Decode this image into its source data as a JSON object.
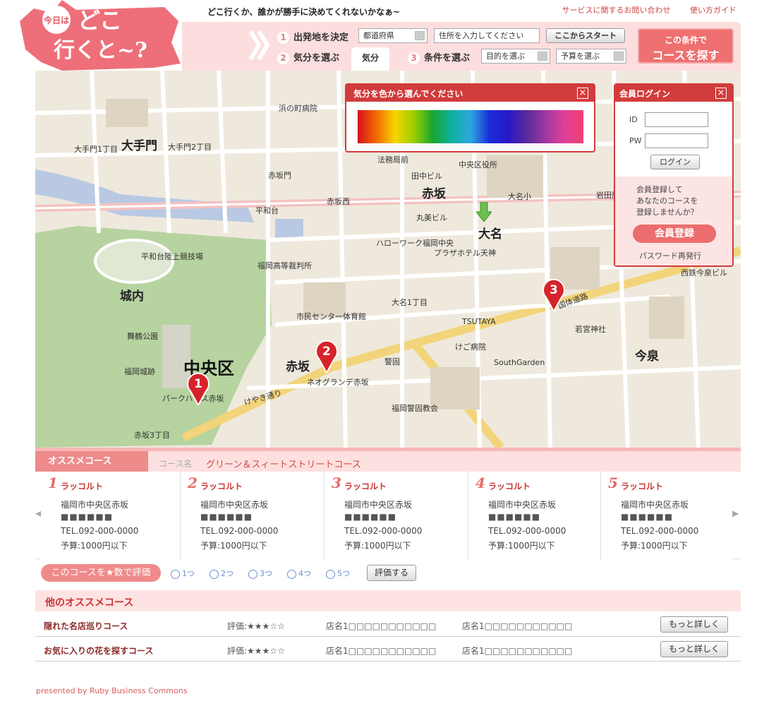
{
  "header": {
    "logo_top": "今日は",
    "logo_main1": "どこ",
    "logo_main2": "行くと~?",
    "tagline": "どこ行くか、誰かが勝手に決めてくれないかなぁ~",
    "links": [
      "サービスに関するお問い合わせ",
      "使い方ガイド"
    ]
  },
  "controls": {
    "step1": {
      "num": "1",
      "label": "出発地を決定",
      "prefecture": "都道府県",
      "address_placeholder": "住所を入力してください",
      "start_button": "ここからスタート"
    },
    "step2": {
      "num": "2",
      "label": "気分を選ぶ",
      "mood_tab": "気分"
    },
    "step3": {
      "num": "3",
      "label": "条件を選ぶ",
      "purpose": "目的を選ぶ",
      "budget": "予算を選ぶ"
    },
    "search_button_line1": "この条件で",
    "search_button_line2": "コースを探す"
  },
  "mood_popup": {
    "title": "気分を色から選んでください",
    "close": "×"
  },
  "login_popup": {
    "title": "会員ログイン",
    "close": "×",
    "id_label": "ID",
    "pw_label": "PW",
    "login_button": "ログイン",
    "register_text1": "会員登録して",
    "register_text2": "あなたのコースを",
    "register_text3": "登録しませんか？",
    "register_button": "会員登録",
    "reissue_link": "パスワード再発行"
  },
  "map": {
    "labels": [
      {
        "t": "大手門",
        "cls": "big"
      },
      {
        "t": "赤坂",
        "cls": "big"
      },
      {
        "t": "大名",
        "cls": "big"
      },
      {
        "t": "中央区",
        "cls": "huge"
      },
      {
        "t": "城内",
        "cls": "big"
      },
      {
        "t": "今泉",
        "cls": "big"
      },
      {
        "t": "赤坂",
        "cls": "big"
      },
      {
        "t": "平和台陸上競技場",
        "cls": ""
      },
      {
        "t": "舞鶴公園",
        "cls": ""
      },
      {
        "t": "福岡城跡",
        "cls": ""
      },
      {
        "t": "市民センター体育館",
        "cls": ""
      },
      {
        "t": "福岡高等裁判所",
        "cls": ""
      },
      {
        "t": "赤坂門",
        "cls": ""
      },
      {
        "t": "平和台",
        "cls": ""
      },
      {
        "t": "赤坂西",
        "cls": ""
      },
      {
        "t": "ハローワーク福岡中央",
        "cls": ""
      },
      {
        "t": "プラザホテル天神",
        "cls": ""
      },
      {
        "t": "大名1丁目",
        "cls": ""
      },
      {
        "t": "TSUTAYA",
        "cls": ""
      },
      {
        "t": "けご病院",
        "cls": ""
      },
      {
        "t": "SouthGarden",
        "cls": ""
      },
      {
        "t": "警固",
        "cls": ""
      },
      {
        "t": "若宮神社",
        "cls": ""
      },
      {
        "t": "国体道路",
        "cls": ""
      },
      {
        "t": "けやき通り",
        "cls": ""
      },
      {
        "t": "ネオグランデ赤坂",
        "cls": ""
      },
      {
        "t": "パークハウス赤坂",
        "cls": ""
      },
      {
        "t": "赤坂3丁目",
        "cls": ""
      },
      {
        "t": "福岡警固教会",
        "cls": ""
      },
      {
        "t": "法務局前",
        "cls": ""
      },
      {
        "t": "中央区役所",
        "cls": ""
      },
      {
        "t": "浜の町病院",
        "cls": ""
      },
      {
        "t": "田中ビル",
        "cls": ""
      },
      {
        "t": "大名小",
        "cls": ""
      },
      {
        "t": "丸美ビル",
        "cls": ""
      },
      {
        "t": "岩田屋",
        "cls": ""
      },
      {
        "t": "西鉄今泉ビル",
        "cls": ""
      },
      {
        "t": "大手門1丁目",
        "cls": ""
      },
      {
        "t": "大手門2丁目",
        "cls": ""
      }
    ],
    "pins": [
      "1",
      "2",
      "3"
    ]
  },
  "recommend": {
    "tab": "オススメコース",
    "course_label": "コース名",
    "course_name": "グリーン＆スィートストリートコース",
    "courses": [
      {
        "num": "1",
        "name": "ラッコルト",
        "addr": "福岡市中央区赤坂",
        "mask": "■■■■■■",
        "tel": "TEL.092-000-0000",
        "budget": "予算:1000円以下"
      },
      {
        "num": "2",
        "name": "ラッコルト",
        "addr": "福岡市中央区赤坂",
        "mask": "■■■■■■",
        "tel": "TEL.092-000-0000",
        "budget": "予算:1000円以下"
      },
      {
        "num": "3",
        "name": "ラッコルト",
        "addr": "福岡市中央区赤坂",
        "mask": "■■■■■■",
        "tel": "TEL.092-000-0000",
        "budget": "予算:1000円以下"
      },
      {
        "num": "4",
        "name": "ラッコルト",
        "addr": "福岡市中央区赤坂",
        "mask": "■■■■■■",
        "tel": "TEL.092-000-0000",
        "budget": "予算:1000円以下"
      },
      {
        "num": "5",
        "name": "ラッコルト",
        "addr": "福岡市中央区赤坂",
        "mask": "■■■■■■",
        "tel": "TEL.092-000-0000",
        "budget": "予算:1000円以下"
      }
    ]
  },
  "rating": {
    "label": "このコースを★数で評価",
    "options": [
      "1つ",
      "2つ",
      "3つ",
      "4つ",
      "5つ"
    ],
    "submit": "評価する"
  },
  "other": {
    "title": "他のオススメコース",
    "rows": [
      {
        "name": "隠れた名店巡りコース",
        "rating": "評価:★★★☆☆",
        "shop1": "店名1□□□□□□□□□□□",
        "shop2": "店名1□□□□□□□□□□□",
        "button": "もっと詳しく"
      },
      {
        "name": "お気に入りの花を探すコース",
        "rating": "評価:★★★☆☆",
        "shop1": "店名1□□□□□□□□□□□",
        "shop2": "店名1□□□□□□□□□□□",
        "button": "もっと詳しく"
      }
    ]
  },
  "footer": {
    "text": "presented by Ruby Business Commons"
  },
  "colors": {
    "accent": "#d23b3b",
    "pink_light": "#fde0e0",
    "pink": "#ee8b8b"
  }
}
